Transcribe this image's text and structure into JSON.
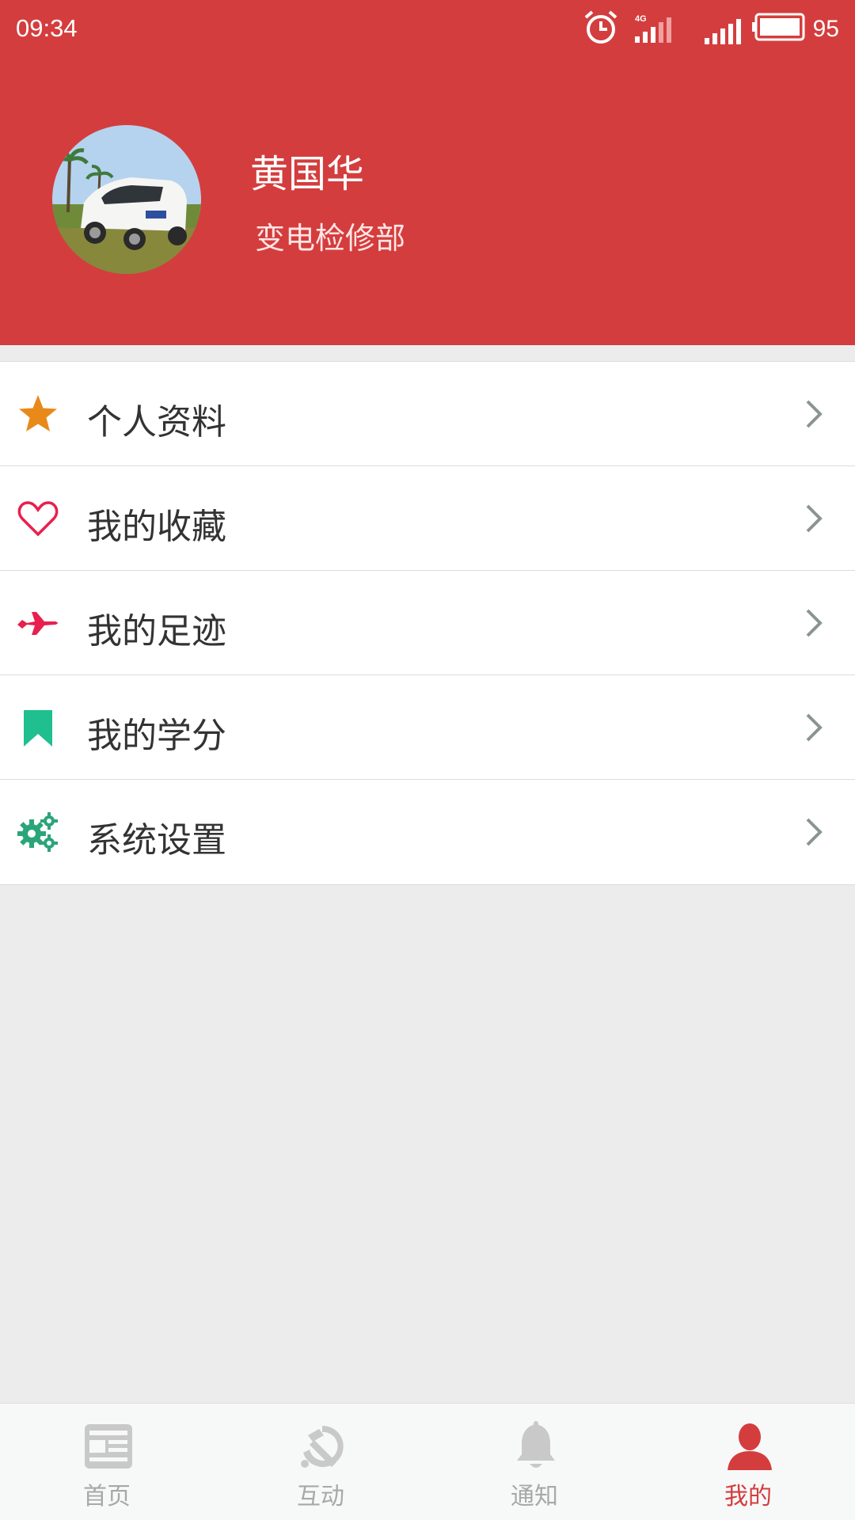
{
  "status_bar": {
    "time": "09:34",
    "network_label": "4G",
    "battery": "95"
  },
  "profile": {
    "name": "黄国华",
    "department": "变电检修部"
  },
  "menu": [
    {
      "label": "个人资料",
      "icon": "star-icon",
      "color": "#e8891a"
    },
    {
      "label": "我的收藏",
      "icon": "heart-icon",
      "color": "#e8204e"
    },
    {
      "label": "我的足迹",
      "icon": "airplane-icon",
      "color": "#e8204e"
    },
    {
      "label": "我的学分",
      "icon": "bookmark-icon",
      "color": "#1fbf8f"
    },
    {
      "label": "系统设置",
      "icon": "gears-icon",
      "color": "#2aa57a"
    }
  ],
  "tabs": [
    {
      "label": "首页",
      "icon": "news-icon",
      "active": false
    },
    {
      "label": "互动",
      "icon": "hammer-sickle-icon",
      "active": false
    },
    {
      "label": "通知",
      "icon": "bell-icon",
      "active": false
    },
    {
      "label": "我的",
      "icon": "user-icon",
      "active": true
    }
  ],
  "colors": {
    "header": "#d43d3d",
    "background": "#ececec",
    "active_tab": "#d43d3d",
    "inactive_tab": "#a8a8a8"
  }
}
